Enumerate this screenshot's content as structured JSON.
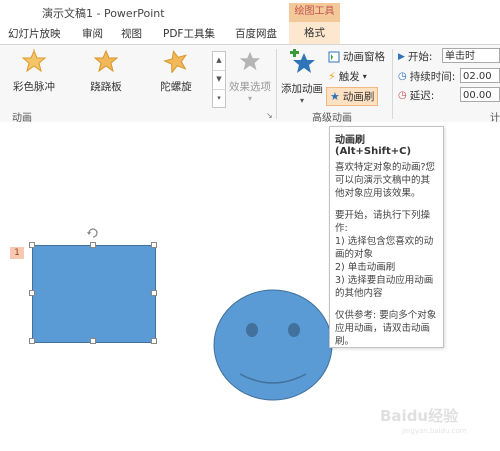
{
  "window": {
    "title": "演示文稿1 - PowerPoint",
    "context_group": "绘图工具"
  },
  "tabs": [
    "幻灯片放映",
    "审阅",
    "视图",
    "PDF工具集",
    "百度网盘"
  ],
  "active_tab": "格式",
  "ribbon": {
    "effects": [
      "彩色脉冲",
      "跷跷板",
      "陀螺旋"
    ],
    "effect_options": "效果选项",
    "group_animation": "动画",
    "add_animation": "添加动画",
    "animation_pane": "动画窗格",
    "trigger": "触发",
    "animation_painter": "动画刷",
    "group_advanced": "高级动画",
    "start_label": "开始:",
    "start_value": "单击时",
    "duration_label": "持续时间:",
    "duration_value": "02.00",
    "delay_label": "延迟:",
    "delay_value": "00.00",
    "group_timing_partial": "计"
  },
  "tooltip": {
    "title": "动画刷 (Alt+Shift+C)",
    "p1": "喜欢特定对象的动画?您可以向演示文稿中的其他对象应用该效果。",
    "p2": "要开始，请执行下列操作:",
    "steps": [
      "1) 选择包含您喜欢的动画的对象",
      "2) 单击动画刷",
      "3) 选择要自动应用动画的其他内容"
    ],
    "p3": "仅供参考: 要向多个对象应用动画，请双击动画刷。"
  },
  "slide": {
    "animation_number": "1"
  },
  "watermark": {
    "main": "Baidu经验",
    "sub": "jingyan.baidu.com"
  },
  "colors": {
    "shape_fill": "#5b9bd5",
    "context_tab": "#f4c99a",
    "accent": "#c0504d"
  }
}
